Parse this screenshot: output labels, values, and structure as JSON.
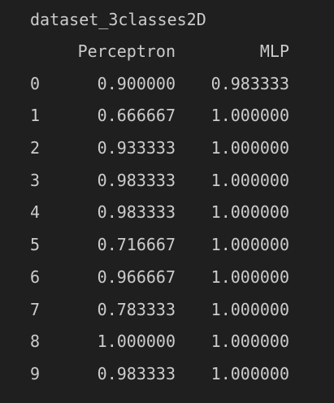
{
  "title": "dataset_3classes2D",
  "table": {
    "columns": [
      "Perceptron",
      "MLP"
    ],
    "rows": [
      {
        "index": "0",
        "perceptron": "0.900000",
        "mlp": "0.983333"
      },
      {
        "index": "1",
        "perceptron": "0.666667",
        "mlp": "1.000000"
      },
      {
        "index": "2",
        "perceptron": "0.933333",
        "mlp": "1.000000"
      },
      {
        "index": "3",
        "perceptron": "0.983333",
        "mlp": "1.000000"
      },
      {
        "index": "4",
        "perceptron": "0.983333",
        "mlp": "1.000000"
      },
      {
        "index": "5",
        "perceptron": "0.716667",
        "mlp": "1.000000"
      },
      {
        "index": "6",
        "perceptron": "0.966667",
        "mlp": "1.000000"
      },
      {
        "index": "7",
        "perceptron": "0.783333",
        "mlp": "1.000000"
      },
      {
        "index": "8",
        "perceptron": "1.000000",
        "mlp": "1.000000"
      },
      {
        "index": "9",
        "perceptron": "0.983333",
        "mlp": "1.000000"
      }
    ]
  },
  "colors": {
    "background": "#1f1f1f",
    "text": "#cccccc"
  }
}
